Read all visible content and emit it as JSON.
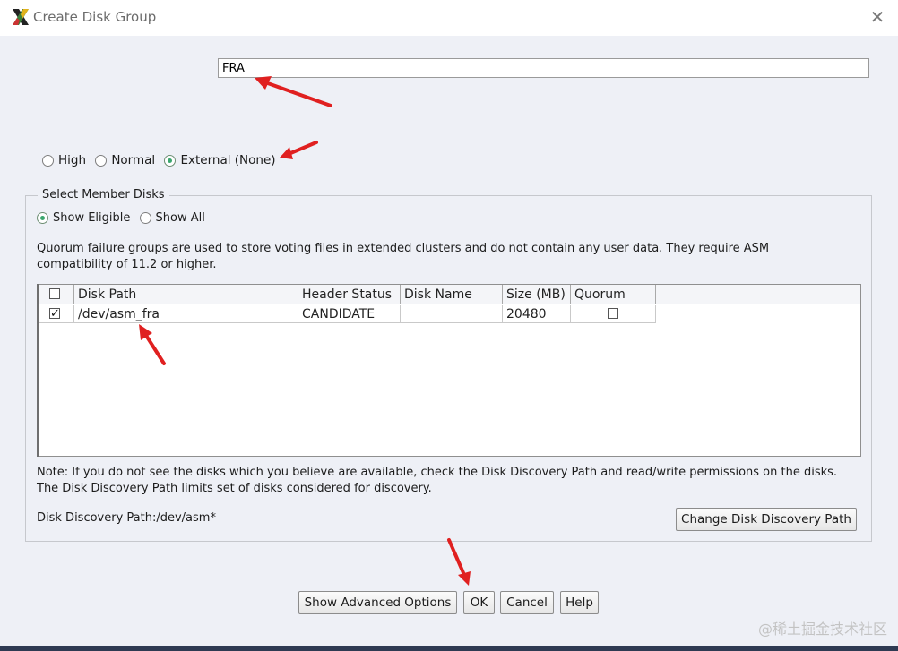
{
  "window": {
    "title": "Create Disk Group"
  },
  "disk_group_name": {
    "value": "FRA"
  },
  "redundancy": {
    "options": [
      {
        "label": "High",
        "selected": false
      },
      {
        "label": "Normal",
        "selected": false
      },
      {
        "label": "External (None)",
        "selected": true
      }
    ]
  },
  "member_disks": {
    "legend": "Select Member Disks",
    "filter_options": [
      {
        "label": "Show Eligible",
        "selected": true
      },
      {
        "label": "Show All",
        "selected": false
      }
    ],
    "description": "Quorum failure groups are used to store voting files in extended clusters and do not contain any user data. They require ASM compatibility of 11.2 or higher.",
    "table": {
      "columns": [
        "Disk Path",
        "Header Status",
        "Disk Name",
        "Size (MB)",
        "Quorum"
      ],
      "rows": [
        {
          "selected": true,
          "disk_path": "/dev/asm_fra",
          "header_status": "CANDIDATE",
          "disk_name": "",
          "size_mb": "20480",
          "quorum": false
        }
      ]
    },
    "note": "Note: If you do not see the disks which you believe are available, check the Disk Discovery Path and read/write permissions on the disks. The Disk Discovery Path limits set of disks considered for discovery.",
    "discovery_path_label": "Disk Discovery Path:/dev/asm*",
    "change_path_button": "Change Disk Discovery Path"
  },
  "buttons": {
    "advanced": "Show Advanced Options",
    "ok": "OK",
    "cancel": "Cancel",
    "help": "Help"
  },
  "watermark": "@稀土掘金技术社区",
  "colors": {
    "annotation_arrow": "#e02020",
    "radio_selected": "#3aa66e",
    "dialog_background": "#eef0f6"
  }
}
